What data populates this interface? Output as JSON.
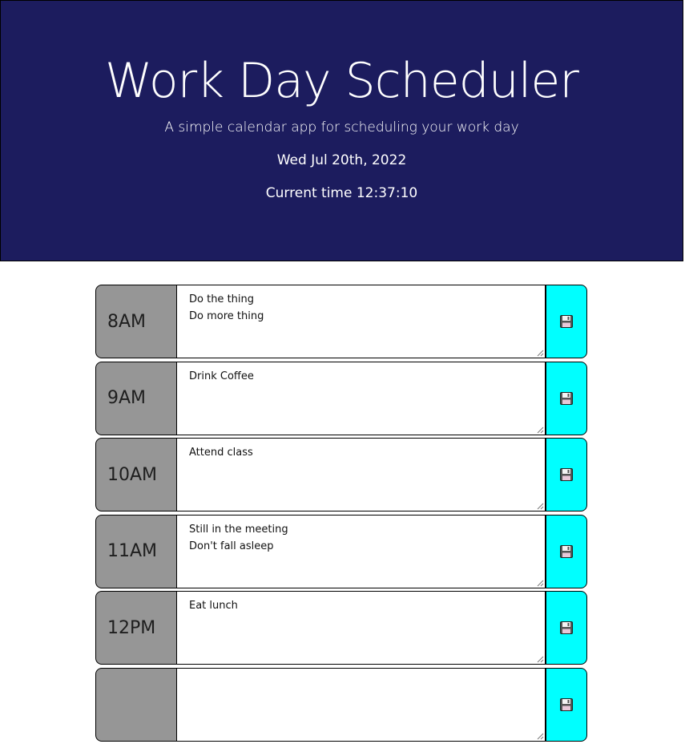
{
  "header": {
    "title": "Work Day Scheduler",
    "subtitle": "A simple calendar app for scheduling your work day",
    "date": "Wed Jul 20th, 2022",
    "current_time": "Current time 12:37:10"
  },
  "colors": {
    "header_bg": "#1c1c5e",
    "hour_bg": "#969696",
    "save_bg": "#00ffff"
  },
  "time_blocks": [
    {
      "hour": "8AM",
      "text": "Do the thing\nDo more thing",
      "save_icon": "floppy-disk-icon"
    },
    {
      "hour": "9AM",
      "text": "Drink Coffee",
      "save_icon": "floppy-disk-icon"
    },
    {
      "hour": "10AM",
      "text": "Attend class",
      "save_icon": "floppy-disk-icon"
    },
    {
      "hour": "11AM",
      "text": "Still in the meeting\nDon't fall asleep",
      "save_icon": "floppy-disk-icon"
    },
    {
      "hour": "12PM",
      "text": "Eat lunch",
      "save_icon": "floppy-disk-icon"
    },
    {
      "hour": "",
      "text": "",
      "save_icon": "floppy-disk-icon"
    }
  ]
}
